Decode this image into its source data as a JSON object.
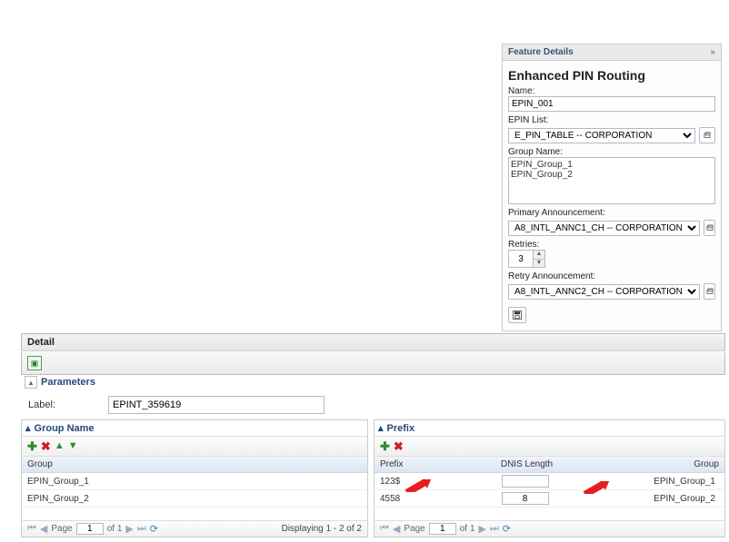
{
  "featureDetails": {
    "titlebar": "Feature Details",
    "heading": "Enhanced PIN Routing",
    "name_label": "Name:",
    "name_value": "EPIN_001",
    "epinlist_label": "EPIN List:",
    "epinlist_value": "E_PIN_TABLE -- CORPORATION",
    "groupname_label": "Group Name:",
    "groups": [
      "EPIN_Group_1",
      "EPIN_Group_2"
    ],
    "primary_ann_label": "Primary Announcement:",
    "primary_ann_value": "A8_INTL_ANNC1_CH -- CORPORATION",
    "retries_label": "Retries:",
    "retries_value": "3",
    "retry_ann_label": "Retry Announcement:",
    "retry_ann_value": "A8_INTL_ANNC2_CH -- CORPORATION"
  },
  "detail": {
    "bar_text": "Detail",
    "parameters_title": "Parameters",
    "label_label": "Label:",
    "label_value": "EPINT_359619"
  },
  "groupPanel": {
    "title": "Group Name",
    "col_group": "Group",
    "rows": [
      "EPIN_Group_1",
      "EPIN_Group_2"
    ],
    "page_word": "Page",
    "page_val": "1",
    "of_word": "of 1",
    "display": "Displaying 1 - 2 of 2"
  },
  "prefixPanel": {
    "title": "Prefix",
    "col_prefix": "Prefix",
    "col_dnis": "DNIS Length",
    "col_group": "Group",
    "rows": [
      {
        "prefix": "123$",
        "dnis": "",
        "group": "EPIN_Group_1"
      },
      {
        "prefix": "4558",
        "dnis": "8",
        "group": "EPIN_Group_2"
      }
    ],
    "page_word": "Page",
    "page_val": "1",
    "of_word": "of 1"
  }
}
